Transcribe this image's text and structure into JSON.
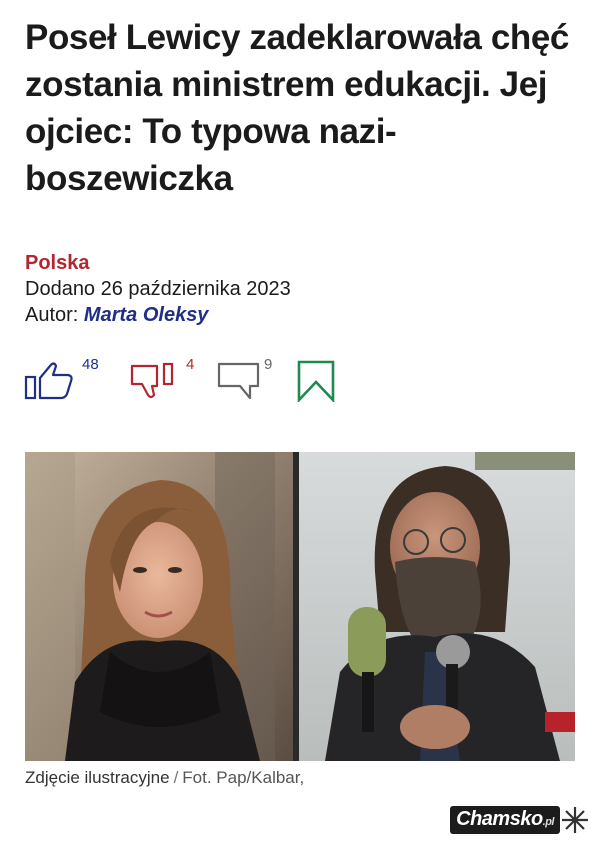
{
  "article": {
    "title": "Poseł Lewicy zadeklarowała chęć zostania ministrem edukacji. Jej ojciec: To typowa nazi-boszewiczka",
    "category": "Polska",
    "added": "Dodano 26 października 2023",
    "author_label": "Autor:",
    "author_name": "Marta Oleksy"
  },
  "reactions": {
    "likes": "48",
    "dislikes": "4",
    "comments": "9"
  },
  "photo": {
    "caption": "Zdjęcie ilustracyjne",
    "separator": "/",
    "credit": "Fot. Pap/Kalbar,"
  },
  "watermark": {
    "brand": "Chamsko",
    "tld": ".pl"
  },
  "colors": {
    "brand_red": "#b3262f",
    "brand_navy": "#1f2f86",
    "bookmark_green": "#1e8a4f"
  }
}
